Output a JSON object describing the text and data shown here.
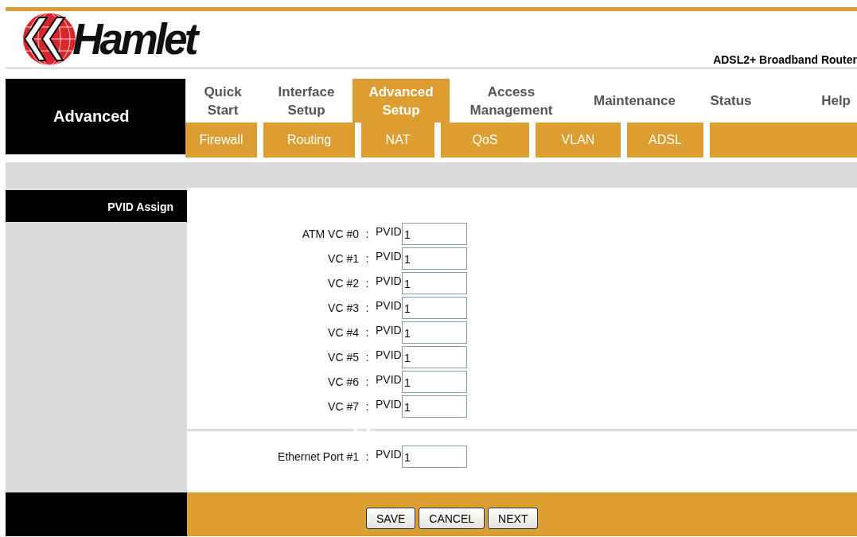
{
  "header": {
    "logo": "Hamlet",
    "product": "ADSL2+ Broadband Router"
  },
  "section": "Advanced",
  "tabs": [
    {
      "label": "Quick\nStart",
      "selected": false
    },
    {
      "label": "Interface\nSetup",
      "selected": false
    },
    {
      "label": "Advanced\nSetup",
      "selected": true
    },
    {
      "label": "Access\nManagement",
      "selected": false
    },
    {
      "label": "Maintenance",
      "selected": false
    },
    {
      "label": "Status",
      "selected": false
    },
    {
      "label": "Help",
      "selected": false
    }
  ],
  "subtabs": [
    "Firewall",
    "Routing",
    "NAT",
    "QoS",
    "VLAN",
    "ADSL"
  ],
  "sidebar": {
    "heading": "PVID Assign"
  },
  "vc_rows": [
    {
      "label": "ATM VC #0",
      "separator": ":",
      "field_label": "PVID",
      "value": "1"
    },
    {
      "label": "VC #1",
      "separator": ":",
      "field_label": "PVID",
      "value": "1"
    },
    {
      "label": "VC #2",
      "separator": ":",
      "field_label": "PVID",
      "value": "1"
    },
    {
      "label": "VC #3",
      "separator": ":",
      "field_label": "PVID",
      "value": "1"
    },
    {
      "label": "VC #4",
      "separator": ":",
      "field_label": "PVID",
      "value": "1"
    },
    {
      "label": "VC #5",
      "separator": ":",
      "field_label": "PVID",
      "value": "1"
    },
    {
      "label": "VC #6",
      "separator": ":",
      "field_label": "PVID",
      "value": "1"
    },
    {
      "label": "VC #7",
      "separator": ":",
      "field_label": "PVID",
      "value": "1"
    }
  ],
  "port_rows": [
    {
      "label": "Ethernet Port #1",
      "separator": ":",
      "field_label": "PVID",
      "value": "1"
    }
  ],
  "buttons": [
    "SAVE",
    "CANCEL",
    "NEXT"
  ]
}
